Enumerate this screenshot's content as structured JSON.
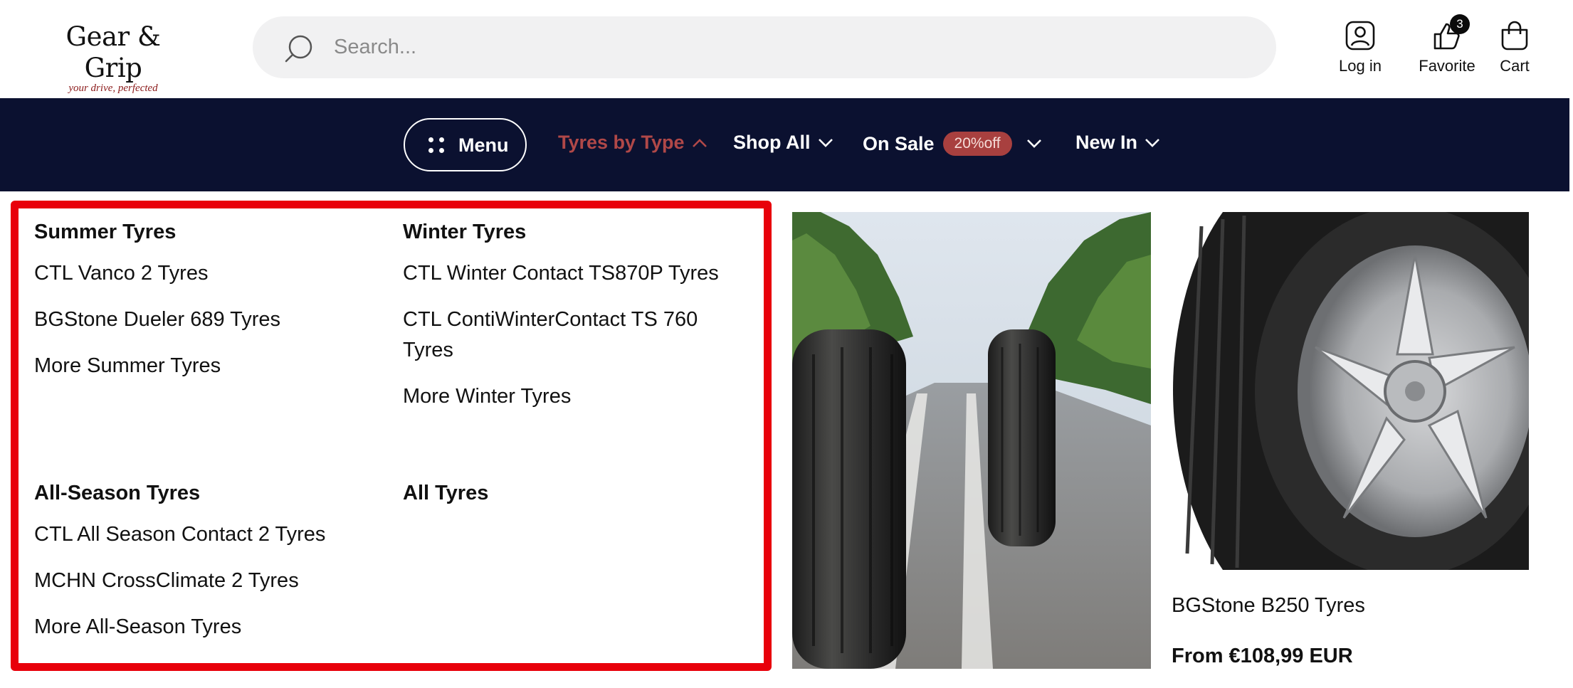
{
  "brand": {
    "name": "Gear & Grip",
    "tagline": "your drive, perfected"
  },
  "search": {
    "placeholder": "Search..."
  },
  "header_actions": {
    "login_label": "Log in",
    "favorite_label": "Favorite",
    "favorite_count": "3",
    "cart_label": "Cart"
  },
  "nav": {
    "menu_label": "Menu",
    "tyres_by_type": "Tyres by Type",
    "shop_all": "Shop All",
    "on_sale": "On Sale",
    "sale_badge": "20%off",
    "new_in": "New In"
  },
  "mega_menu": {
    "summer": {
      "title": "Summer Tyres",
      "links": [
        "CTL Vanco 2 Tyres",
        "BGStone Dueler 689 Tyres",
        "More Summer Tyres"
      ]
    },
    "winter": {
      "title": "Winter Tyres",
      "links": [
        "CTL Winter Contact TS870P Tyres",
        "CTL ContiWinterContact TS 760",
        "Tyres",
        "More Winter Tyres"
      ]
    },
    "all_season": {
      "title": "All-Season Tyres",
      "links": [
        "CTL All Season Contact 2 Tyres",
        "MCHN CrossClimate 2 Tyres",
        "More All-Season Tyres"
      ]
    },
    "all": {
      "title": "All Tyres"
    }
  },
  "featured_product": {
    "name": "BGStone B250 Tyres",
    "price": "From €108,99 EUR"
  },
  "colors": {
    "navbar_bg": "#0b1130",
    "accent_red": "#b04848",
    "sale_badge_bg": "#a8403f",
    "highlight_border": "#e8000b"
  }
}
